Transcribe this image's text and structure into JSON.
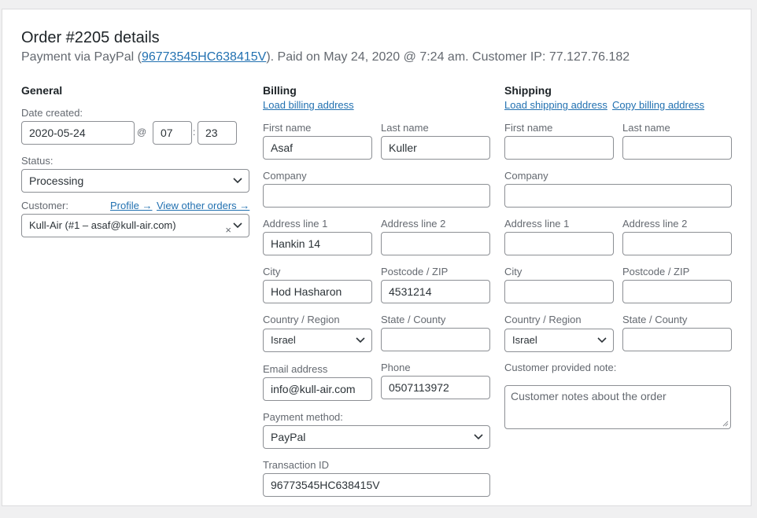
{
  "order": {
    "title": "Order #2205 details",
    "subtitle_prefix": "Payment via PayPal (",
    "transaction_link": "96773545HC638415V",
    "subtitle_suffix": "). Paid on May 24, 2020 @ 7:24 am. Customer IP: 77.127.76.182"
  },
  "general": {
    "title": "General",
    "date_label": "Date created:",
    "date_value": "2020-05-24",
    "at_sep": "@",
    "hour_value": "07",
    "time_sep": ":",
    "minute_value": "23",
    "status_label": "Status:",
    "status_value": "Processing",
    "customer_label": "Customer:",
    "profile_link": "Profile →",
    "other_orders_link": "View other orders →",
    "customer_value": "Kull-Air (#1 – asaf@kull-air.com)",
    "clear_glyph": "×"
  },
  "billing": {
    "title": "Billing",
    "load_link": "Load billing address",
    "first_name_label": "First name",
    "first_name": "Asaf",
    "last_name_label": "Last name",
    "last_name": "Kuller",
    "company_label": "Company",
    "company": "",
    "address1_label": "Address line 1",
    "address1": "Hankin 14",
    "address2_label": "Address line 2",
    "address2": "",
    "city_label": "City",
    "city": "Hod Hasharon",
    "postcode_label": "Postcode / ZIP",
    "postcode": "4531214",
    "country_label": "Country / Region",
    "country": "Israel",
    "state_label": "State / County",
    "state": "",
    "email_label": "Email address",
    "email": "info@kull-air.com",
    "phone_label": "Phone",
    "phone": "0507113972",
    "payment_label": "Payment method:",
    "payment": "PayPal",
    "txn_label": "Transaction ID",
    "txn": "96773545HC638415V"
  },
  "shipping": {
    "title": "Shipping",
    "load_link": "Load shipping address",
    "copy_link": "Copy billing address",
    "first_name_label": "First name",
    "last_name_label": "Last name",
    "company_label": "Company",
    "address1_label": "Address line 1",
    "address2_label": "Address line 2",
    "city_label": "City",
    "postcode_label": "Postcode / ZIP",
    "country_label": "Country / Region",
    "country": "Israel",
    "state_label": "State / County",
    "note_label": "Customer provided note:",
    "note_placeholder": "Customer notes about the order"
  },
  "icons": {
    "select_arrow": "chevron-down-icon",
    "resize": "resize-grip-icon"
  },
  "colors": {
    "link": "#2271b1",
    "border": "#8c8f94",
    "text": "#3c434a"
  }
}
